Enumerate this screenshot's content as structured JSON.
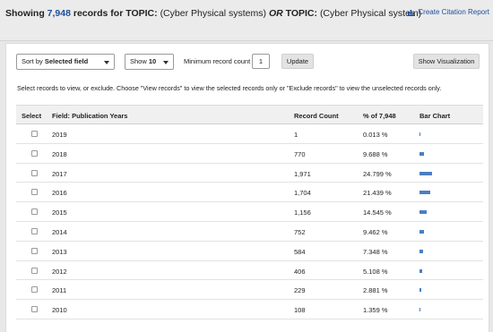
{
  "header": {
    "showing_label": "Showing",
    "record_total": "7,948",
    "records_for": "records for",
    "topic_kw1": "TOPIC:",
    "topic_val1": "(Cyber Physical systems)",
    "or_label": "OR",
    "topic_kw2": "TOPIC:",
    "topic_val2": "(Cyber Physical system)",
    "citation_link": "Create Citation Report"
  },
  "controls": {
    "sort_prefix": "Sort by",
    "sort_value": "Selected field",
    "show_prefix": "Show",
    "show_value": "10",
    "min_label": "Minimum record count",
    "min_value": "1",
    "update_label": "Update",
    "viz_label": "Show Visualization"
  },
  "instructions": "Select records to view, or exclude. Choose \"View records\" to view the selected records only or \"Exclude records\" to view the unselected records only.",
  "table": {
    "headers": {
      "select": "Select",
      "field": "Field: Publication Years",
      "count": "Record Count",
      "pct": "% of 7,948",
      "bar": "Bar Chart"
    },
    "rows": [
      {
        "year": "2019",
        "count": "1",
        "pct": "0.013 %",
        "share": 0.013
      },
      {
        "year": "2018",
        "count": "770",
        "pct": "9.688 %",
        "share": 9.688
      },
      {
        "year": "2017",
        "count": "1,971",
        "pct": "24.799 %",
        "share": 24.799
      },
      {
        "year": "2016",
        "count": "1,704",
        "pct": "21.439 %",
        "share": 21.439
      },
      {
        "year": "2015",
        "count": "1,156",
        "pct": "14.545 %",
        "share": 14.545
      },
      {
        "year": "2014",
        "count": "752",
        "pct": "9.462 %",
        "share": 9.462
      },
      {
        "year": "2013",
        "count": "584",
        "pct": "7.348 %",
        "share": 7.348
      },
      {
        "year": "2012",
        "count": "406",
        "pct": "5.108 %",
        "share": 5.108
      },
      {
        "year": "2011",
        "count": "229",
        "pct": "2.881 %",
        "share": 2.881
      },
      {
        "year": "2010",
        "count": "108",
        "pct": "1.359 %",
        "share": 1.359
      }
    ]
  },
  "colors": {
    "accent": "#1f4e9c",
    "bar": "#4a7fc1"
  }
}
